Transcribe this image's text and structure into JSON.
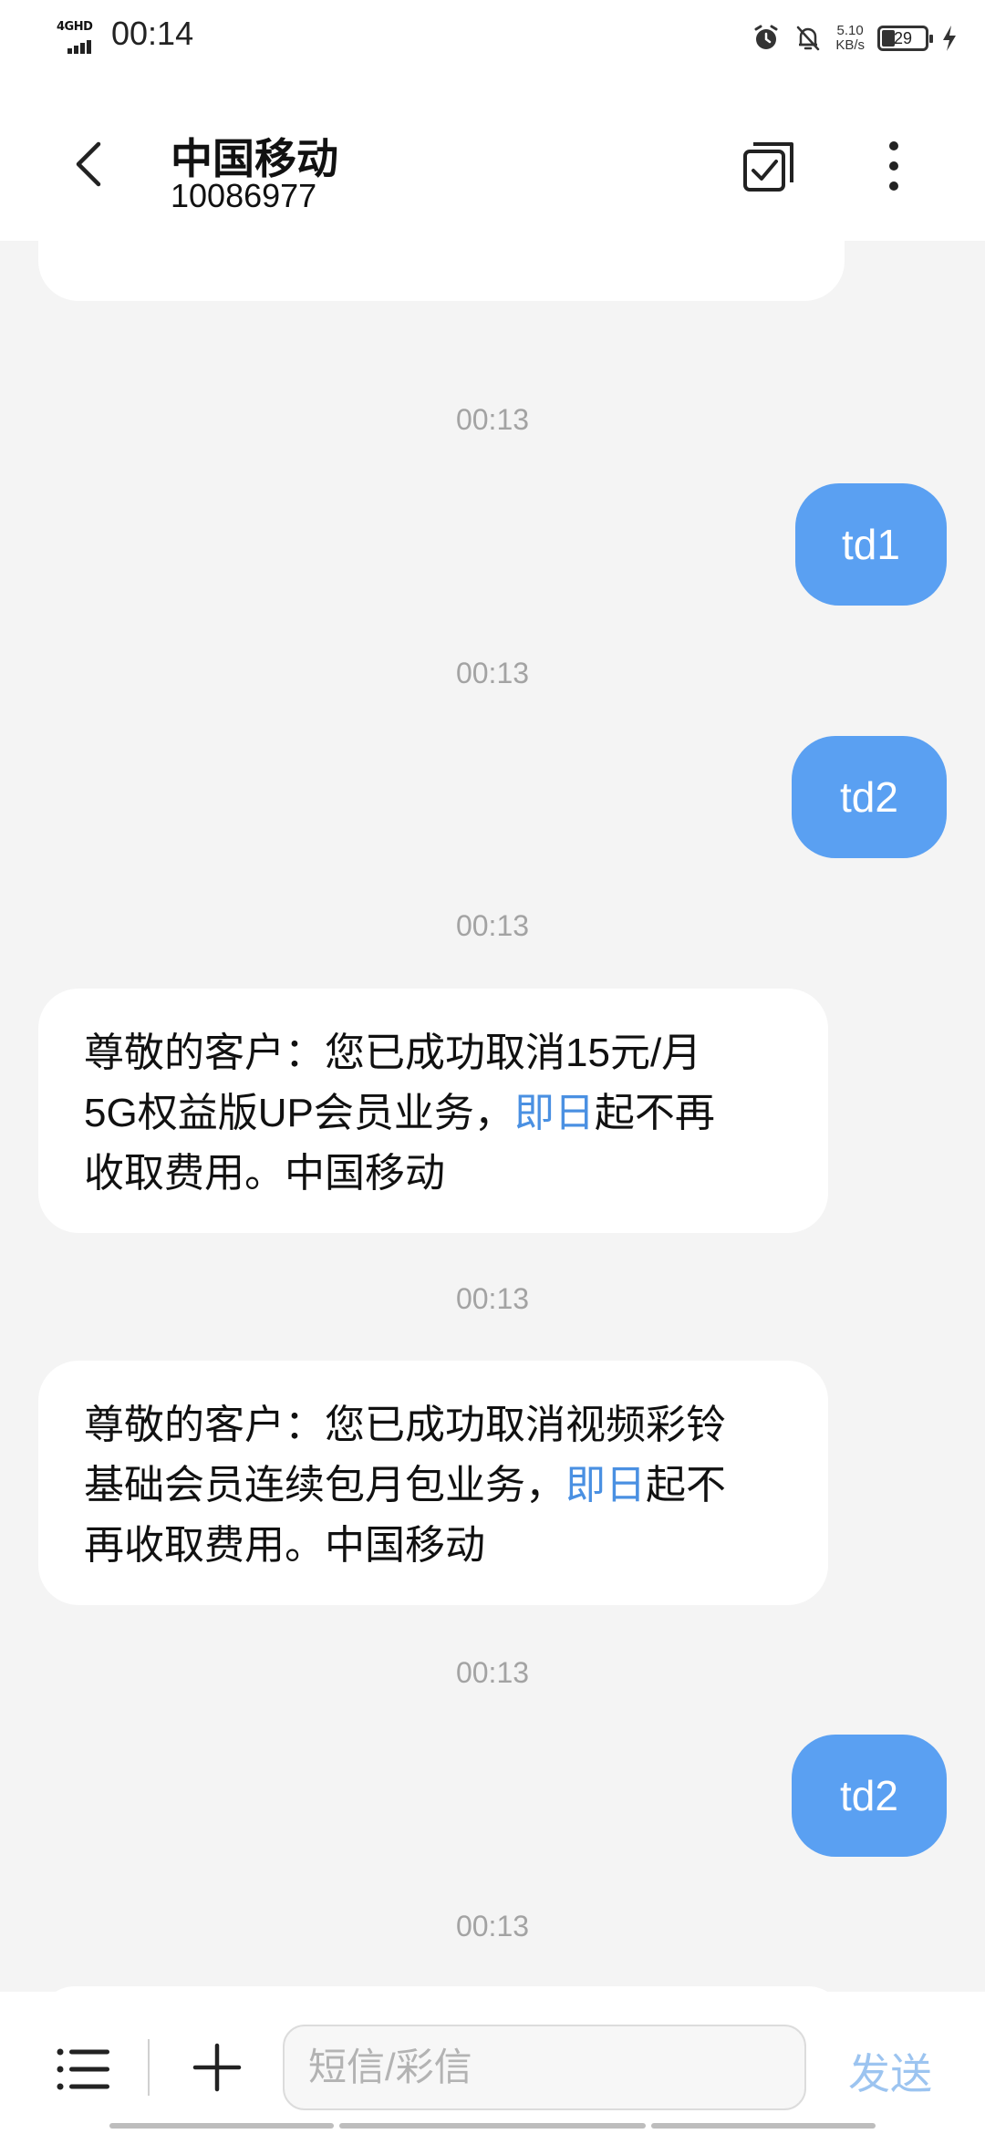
{
  "status_bar": {
    "network": "4GHD",
    "time": "00:14",
    "speed_value": "5.10",
    "speed_unit": "KB/s",
    "battery": "29",
    "icons": [
      "alarm-icon",
      "mute-notification-icon",
      "charging-icon"
    ]
  },
  "header": {
    "contact_name": "中国移动",
    "contact_number": "10086977",
    "icons": [
      "back-arrow-icon",
      "multi-select-icon",
      "more-vertical-icon"
    ]
  },
  "messages": [
    {
      "type": "timestamp",
      "text": "00:13"
    },
    {
      "type": "sent",
      "text": "td1"
    },
    {
      "type": "timestamp",
      "text": "00:13"
    },
    {
      "type": "sent",
      "text": "td2"
    },
    {
      "type": "timestamp",
      "text": "00:13"
    },
    {
      "type": "received",
      "lines": [
        "尊敬的客户：您已成功取消15元/月",
        "5G权益版UP会员业务，",
        "即日",
        "起不再",
        "收取费用。中国移动"
      ]
    },
    {
      "type": "timestamp",
      "text": "00:13"
    },
    {
      "type": "received",
      "lines": [
        "尊敬的客户：您已成功取消视频彩铃",
        "基础会员连续包月包业务，",
        "即日",
        "起不",
        "再收取费用。中国移动"
      ]
    },
    {
      "type": "timestamp",
      "text": "00:13"
    },
    {
      "type": "sent",
      "text": "td2"
    },
    {
      "type": "timestamp",
      "text": "00:13"
    }
  ],
  "input": {
    "placeholder": "短信/彩信",
    "send_label": "发送"
  },
  "colors": {
    "sent_bubble": "#5aa0f2",
    "link": "#4a90e2",
    "background": "#f4f4f4",
    "send_disabled": "#9cc4f0"
  }
}
